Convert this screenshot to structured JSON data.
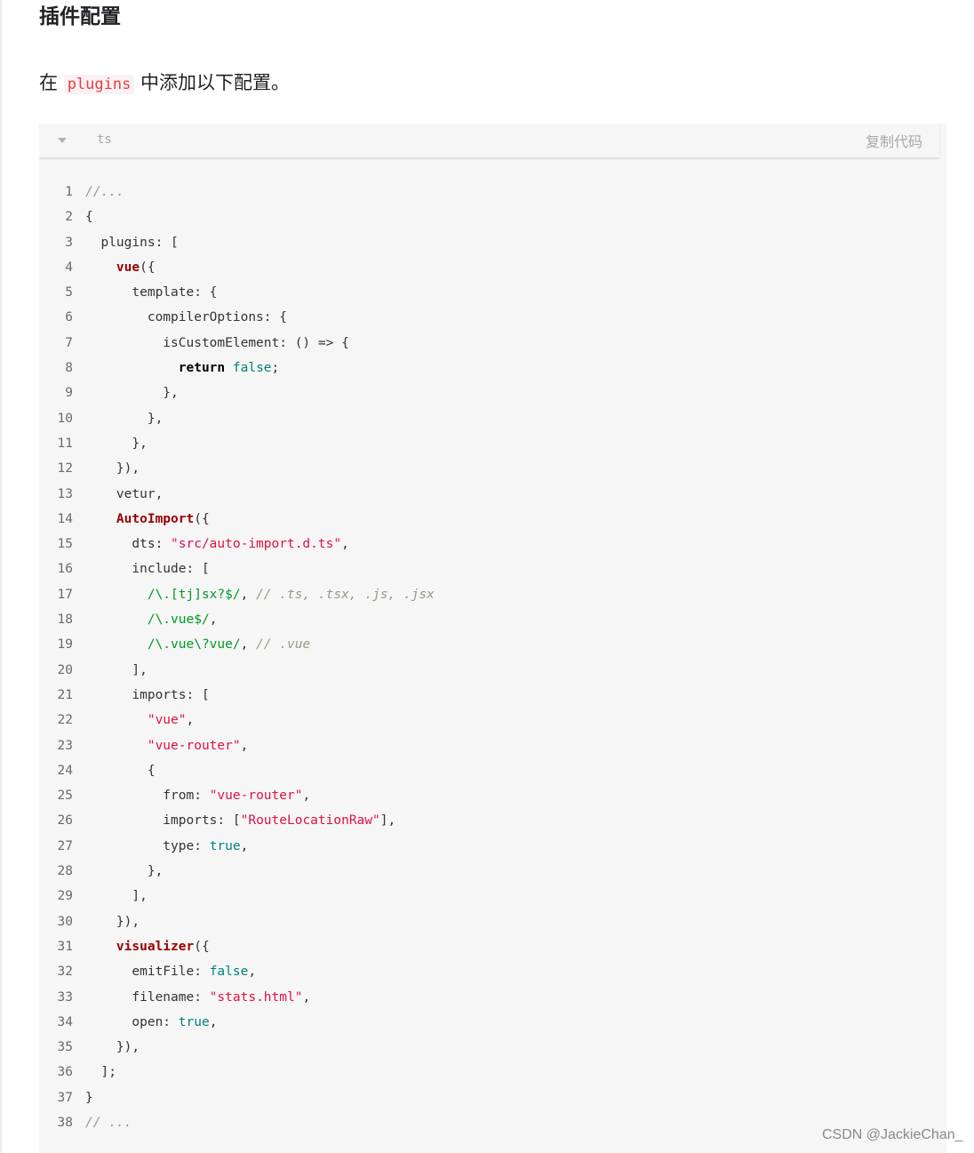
{
  "heading": "插件配置",
  "paragraph": {
    "before": "在",
    "code": "plugins",
    "after": "中添加以下配置。"
  },
  "code_block": {
    "language": "ts",
    "copy_label": "复制代码",
    "lines": [
      [
        [
          "cm",
          "//..."
        ]
      ],
      [
        [
          "p",
          "{"
        ]
      ],
      [
        [
          "p",
          "  plugins: ["
        ]
      ],
      [
        [
          "p",
          "    "
        ],
        [
          "fn",
          "vue"
        ],
        [
          "p",
          "({"
        ]
      ],
      [
        [
          "p",
          "      template: {"
        ]
      ],
      [
        [
          "p",
          "        compilerOptions: {"
        ]
      ],
      [
        [
          "p",
          "          isCustomElement: () => {"
        ]
      ],
      [
        [
          "p",
          "            "
        ],
        [
          "kw",
          "return"
        ],
        [
          "p",
          " "
        ],
        [
          "lit",
          "false"
        ],
        [
          "p",
          ";"
        ]
      ],
      [
        [
          "p",
          "          },"
        ]
      ],
      [
        [
          "p",
          "        },"
        ]
      ],
      [
        [
          "p",
          "      },"
        ]
      ],
      [
        [
          "p",
          "    }),"
        ]
      ],
      [
        [
          "p",
          "    vetur,"
        ]
      ],
      [
        [
          "p",
          "    "
        ],
        [
          "fn",
          "AutoImport"
        ],
        [
          "p",
          "({"
        ]
      ],
      [
        [
          "p",
          "      dts: "
        ],
        [
          "str",
          "\"src/auto-import.d.ts\""
        ],
        [
          "p",
          ","
        ]
      ],
      [
        [
          "p",
          "      include: ["
        ]
      ],
      [
        [
          "p",
          "        "
        ],
        [
          "re",
          "/\\.[tj]sx?$/"
        ],
        [
          "p",
          ", "
        ],
        [
          "cm",
          "// .ts, .tsx, .js, .jsx"
        ]
      ],
      [
        [
          "p",
          "        "
        ],
        [
          "re",
          "/\\.vue$/"
        ],
        [
          "p",
          ","
        ]
      ],
      [
        [
          "p",
          "        "
        ],
        [
          "re",
          "/\\.vue\\?vue/"
        ],
        [
          "p",
          ", "
        ],
        [
          "cm",
          "// .vue"
        ]
      ],
      [
        [
          "p",
          "      ],"
        ]
      ],
      [
        [
          "p",
          "      imports: ["
        ]
      ],
      [
        [
          "p",
          "        "
        ],
        [
          "str",
          "\"vue\""
        ],
        [
          "p",
          ","
        ]
      ],
      [
        [
          "p",
          "        "
        ],
        [
          "str",
          "\"vue-router\""
        ],
        [
          "p",
          ","
        ]
      ],
      [
        [
          "p",
          "        {"
        ]
      ],
      [
        [
          "p",
          "          from: "
        ],
        [
          "str",
          "\"vue-router\""
        ],
        [
          "p",
          ","
        ]
      ],
      [
        [
          "p",
          "          imports: ["
        ],
        [
          "str",
          "\"RouteLocationRaw\""
        ],
        [
          "p",
          "],"
        ]
      ],
      [
        [
          "p",
          "          type: "
        ],
        [
          "lit",
          "true"
        ],
        [
          "p",
          ","
        ]
      ],
      [
        [
          "p",
          "        },"
        ]
      ],
      [
        [
          "p",
          "      ],"
        ]
      ],
      [
        [
          "p",
          "    }),"
        ]
      ],
      [
        [
          "p",
          "    "
        ],
        [
          "fn",
          "visualizer"
        ],
        [
          "p",
          "({"
        ]
      ],
      [
        [
          "p",
          "      emitFile: "
        ],
        [
          "lit",
          "false"
        ],
        [
          "p",
          ","
        ]
      ],
      [
        [
          "p",
          "      filename: "
        ],
        [
          "str",
          "\"stats.html\""
        ],
        [
          "p",
          ","
        ]
      ],
      [
        [
          "p",
          "      open: "
        ],
        [
          "lit",
          "true"
        ],
        [
          "p",
          ","
        ]
      ],
      [
        [
          "p",
          "    }),"
        ]
      ],
      [
        [
          "p",
          "  ];"
        ]
      ],
      [
        [
          "p",
          "}"
        ]
      ],
      [
        [
          "cm",
          "// ..."
        ]
      ]
    ]
  },
  "watermark": "CSDN @JackieChan_"
}
